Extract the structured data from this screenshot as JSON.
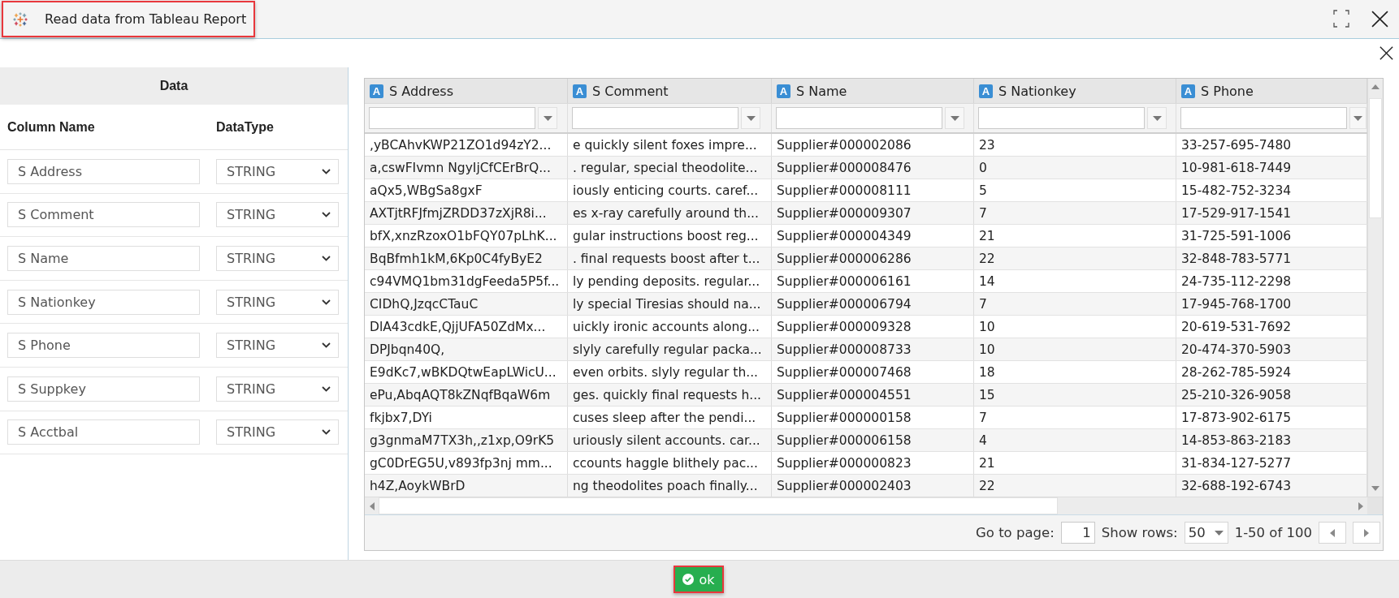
{
  "window": {
    "title": "Read data from Tableau Report",
    "highlighted": true
  },
  "data_panel": {
    "title": "Data",
    "headers": [
      "Column Name",
      "DataType"
    ],
    "rows": [
      {
        "column_name": "S Address",
        "data_type": "STRING"
      },
      {
        "column_name": "S Comment",
        "data_type": "STRING"
      },
      {
        "column_name": "S Name",
        "data_type": "STRING"
      },
      {
        "column_name": "S Nationkey",
        "data_type": "STRING"
      },
      {
        "column_name": "S Phone",
        "data_type": "STRING"
      },
      {
        "column_name": "S Suppkey",
        "data_type": "STRING"
      },
      {
        "column_name": "S Acctbal",
        "data_type": "STRING"
      }
    ]
  },
  "grid": {
    "columns": [
      {
        "label": "S Address",
        "type_badge": "A"
      },
      {
        "label": "S Comment",
        "type_badge": "A"
      },
      {
        "label": "S Name",
        "type_badge": "A"
      },
      {
        "label": "S Nationkey",
        "type_badge": "A"
      },
      {
        "label": "S Phone",
        "type_badge": "A"
      }
    ],
    "rows": [
      [
        ",yBCAhvKWP21ZO1d94zY2...",
        "e quickly silent foxes impre...",
        "Supplier#000002086",
        "23",
        "33-257-695-7480"
      ],
      [
        "a,cswFIvmn NgyIjCfCErBrQ...",
        ". regular, special theodolite...",
        "Supplier#000008476",
        "0",
        "10-981-618-7449"
      ],
      [
        "aQx5,WBgSa8gxF",
        "iously enticing courts. caref...",
        "Supplier#000008111",
        "5",
        "15-482-752-3234"
      ],
      [
        "AXTjtRFJfmjZRDD37zXjR8i...",
        "es x-ray carefully around th...",
        "Supplier#000009307",
        "7",
        "17-529-917-1541"
      ],
      [
        "bfX,xnzRzoxO1bFQY07pLhK...",
        "gular instructions boost reg...",
        "Supplier#000004349",
        "21",
        "31-725-591-1006"
      ],
      [
        "BqBfmh1kM,6Kp0C4fyByE2",
        ". final requests boost after t...",
        "Supplier#000006286",
        "22",
        "32-848-783-5771"
      ],
      [
        "c94VMQ1bm31dgFeeda5P5f...",
        "ly pending deposits. regular...",
        "Supplier#000006161",
        "14",
        "24-735-112-2298"
      ],
      [
        "CIDhQ,JzqcCTauC",
        "ly special Tiresias should na...",
        "Supplier#000006794",
        "7",
        "17-945-768-1700"
      ],
      [
        "DlA43cdkE,QjjUFA50ZdMx...",
        "uickly ironic accounts along...",
        "Supplier#000009328",
        "10",
        "20-619-531-7692"
      ],
      [
        "DPJbqn40Q,",
        "slyly carefully regular packa...",
        "Supplier#000008733",
        "10",
        "20-474-370-5903"
      ],
      [
        "E9dKc7,wBKDQtwEapLWicU...",
        "even orbits. slyly regular th...",
        "Supplier#000007468",
        "18",
        "28-262-785-5924"
      ],
      [
        "ePu,AbqAQT8kZNqfBqaW6m",
        "ges. quickly final requests h...",
        "Supplier#000004551",
        "15",
        "25-210-326-9058"
      ],
      [
        "fkjbx7,DYi",
        "cuses sleep after the pendi...",
        "Supplier#000000158",
        "7",
        "17-873-902-6175"
      ],
      [
        "g3gnmaM7TX3h,,z1xp,O9rK5",
        "uriously silent accounts. car...",
        "Supplier#000006158",
        "4",
        "14-853-863-2183"
      ],
      [
        "gC0DrEG5U,v893fp3nj mm...",
        "ccounts haggle blithely pac...",
        "Supplier#000000823",
        "21",
        "31-834-127-5277"
      ],
      [
        "h4Z,AoykWBrD",
        "ng theodolites poach finally...",
        "Supplier#000002403",
        "22",
        "32-688-192-6743"
      ]
    ]
  },
  "pager": {
    "goto_label": "Go to page:",
    "page": "1",
    "rows_label": "Show rows:",
    "rows_per_page": "50",
    "range": "1-50 of 100"
  },
  "ok_button": {
    "label": "ok",
    "highlighted": true
  }
}
